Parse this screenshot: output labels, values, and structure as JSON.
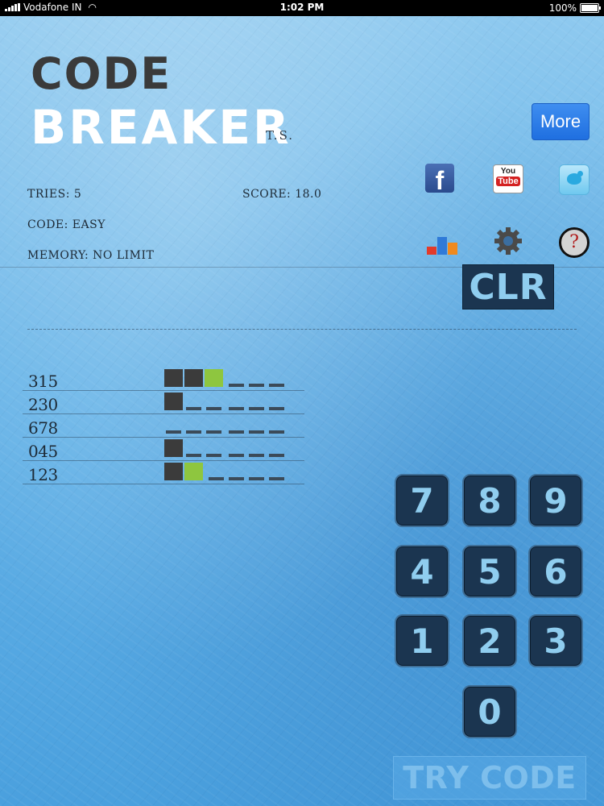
{
  "status": {
    "carrier": "Vodafone IN",
    "time": "1:02 PM",
    "battery": "100%"
  },
  "logo": {
    "line1": "CODE",
    "line2": "BREAKER",
    "suffix": "T.S."
  },
  "more_label": "More",
  "social": {
    "facebook_glyph": "f",
    "youtube_you": "You",
    "youtube_tube": "Tube",
    "help_glyph": "?"
  },
  "info": {
    "tries": "TRIES: 5",
    "score": "SCORE: 18.0",
    "code": "CODE: EASY",
    "memory": "MEMORY: NO LIMIT"
  },
  "clear_label": "CLR",
  "guesses": [
    {
      "code": "315",
      "pegs": [
        "black",
        "black",
        "green",
        "empty",
        "empty",
        "empty"
      ]
    },
    {
      "code": "230",
      "pegs": [
        "black",
        "empty",
        "empty",
        "empty",
        "empty",
        "empty"
      ]
    },
    {
      "code": "678",
      "pegs": [
        "empty",
        "empty",
        "empty",
        "empty",
        "empty",
        "empty"
      ]
    },
    {
      "code": "045",
      "pegs": [
        "black",
        "empty",
        "empty",
        "empty",
        "empty",
        "empty"
      ]
    },
    {
      "code": "123",
      "pegs": [
        "black",
        "green",
        "empty",
        "empty",
        "empty",
        "empty"
      ]
    }
  ],
  "keypad": {
    "k7": "7",
    "k8": "8",
    "k9": "9",
    "k4": "4",
    "k5": "5",
    "k6": "6",
    "k1": "1",
    "k2": "2",
    "k3": "3",
    "k0": "0"
  },
  "try_label": "TRY CODE",
  "colors": {
    "peg_black": "#3b3b3b",
    "peg_green": "#8ec63f",
    "key_bg": "#1b3550",
    "more_button": "#2a7de8"
  }
}
